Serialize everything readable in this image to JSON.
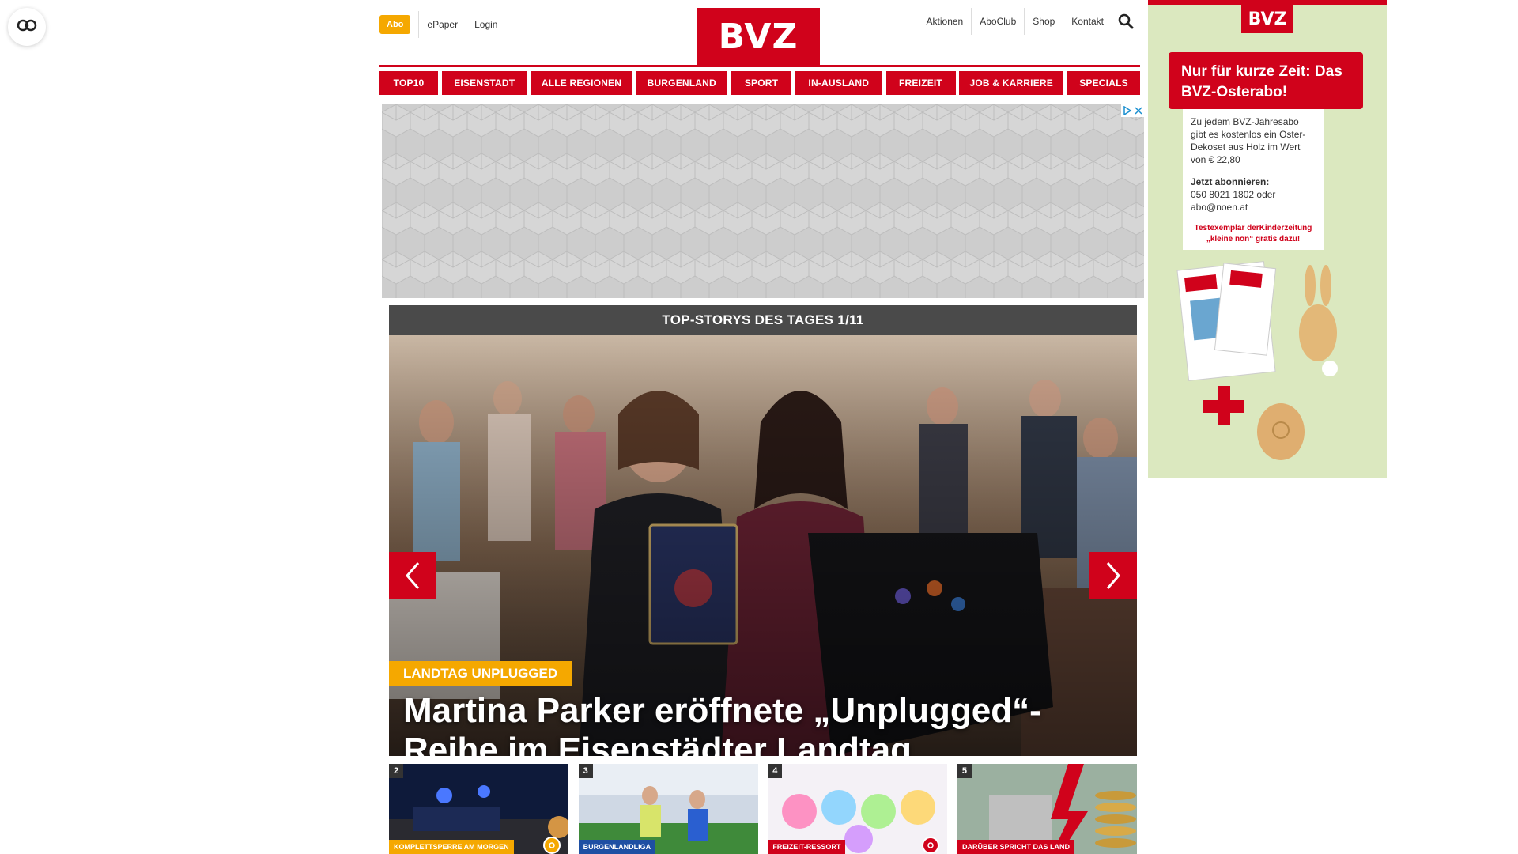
{
  "header": {
    "abo_label": "Abo",
    "epaper_label": "ePaper",
    "login_label": "Login",
    "logo_text": "BVZ",
    "right_links": [
      "Aktionen",
      "AboClub",
      "Shop",
      "Kontakt"
    ]
  },
  "nav": {
    "items": [
      "TOP10",
      "EISENSTADT",
      "ALLE REGIONEN",
      "BURGENLAND",
      "SPORT",
      "IN-AUSLAND",
      "FREIZEIT",
      "JOB & KARRIERE",
      "SPECIALS"
    ]
  },
  "slider": {
    "heading": "TOP-STORYS DES TAGES 1/11",
    "kicker": "LANDTAG UNPLUGGED",
    "title": "Martina Parker eröffnete „Unplugged“-Reihe im Eisenstädter Landtag"
  },
  "thumbs": [
    {
      "num": "2",
      "tag": "KOMPLETTSPERRE AM MORGEN"
    },
    {
      "num": "3",
      "tag": "BURGENLANDLIGA"
    },
    {
      "num": "4",
      "tag": "FREIZEIT-RESSORT"
    },
    {
      "num": "5",
      "tag": "DARÜBER SPRICHT DAS LAND"
    }
  ],
  "side_ad": {
    "logo": "BVZ",
    "headline": "Nur für kurze Zeit: Das BVZ-Osterabo!",
    "body": "Zu jedem BVZ-Jahresabo gibt es kostenlos ein Oster-Dekoset aus Holz im Wert von € 22,80",
    "cta_title": "Jetzt abonnieren:",
    "cta_phone": "050 8021 1802 oder",
    "cta_email": "abo@noen.at",
    "strip_line1": "Testexemplar derKinderzeitung",
    "strip_line2": "„kleine nön“ gratis dazu!"
  },
  "colors": {
    "brand_red": "#d0021b",
    "accent_yellow": "#f5a800"
  },
  "icons": [
    "accessibility-icon",
    "search-icon",
    "chevron-left-icon",
    "chevron-right-icon",
    "camera-icon",
    "adchoices-icon",
    "close-icon"
  ]
}
